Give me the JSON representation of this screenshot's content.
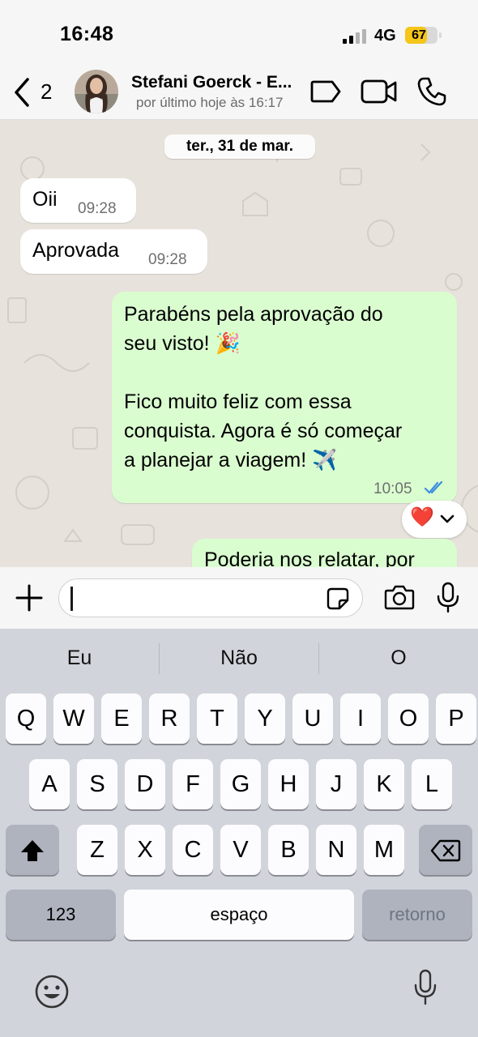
{
  "status_bar": {
    "time": "16:48",
    "network": "4G",
    "battery": "67",
    "battery_level": 0.67,
    "battery_color": "#f5c518"
  },
  "header": {
    "back_count": "2",
    "contact_name": "Stefani Goerck - E...",
    "last_seen": "por último hoje às 16:17"
  },
  "chat": {
    "date": "ter., 31 de mar.",
    "messages": [
      {
        "direction": "in",
        "text": "Oii",
        "time": "09:28"
      },
      {
        "direction": "in",
        "text": "Aprovada",
        "time": "09:28"
      },
      {
        "direction": "out",
        "lines": [
          "Parabéns pela aprovação do",
          "seu visto! 🎉",
          "",
          "Fico muito feliz com essa",
          "conquista. Agora é só começar",
          "a planejar a viagem! ✈️"
        ],
        "time": "10:05",
        "status": "read"
      },
      {
        "direction": "out",
        "text": "Poderia nos relatar, por"
      }
    ],
    "reaction": "❤️"
  },
  "input": {
    "placeholder": ""
  },
  "keyboard": {
    "suggestions": [
      "Eu",
      "Não",
      "O"
    ],
    "row1": [
      "Q",
      "W",
      "E",
      "R",
      "T",
      "Y",
      "U",
      "I",
      "O",
      "P"
    ],
    "row2": [
      "A",
      "S",
      "D",
      "F",
      "G",
      "H",
      "J",
      "K",
      "L"
    ],
    "row3": [
      "Z",
      "X",
      "C",
      "V",
      "B",
      "N",
      "M"
    ],
    "numbers_key": "123",
    "space_key": "espaço",
    "return_key": "retorno"
  },
  "colors": {
    "outgoing_bubble": "#dafdd0",
    "incoming_bubble": "#ffffff",
    "read_ticks": "#3a8de0",
    "chat_background": "#e7e3dc"
  },
  "icons": [
    "chevron-left-icon",
    "tag-icon",
    "video-camera-icon",
    "phone-icon",
    "plus-icon",
    "sticker-icon",
    "camera-icon",
    "microphone-icon",
    "shift-icon",
    "backspace-icon",
    "emoji-icon",
    "dictation-icon",
    "double-check-icon",
    "chevron-down-icon"
  ]
}
